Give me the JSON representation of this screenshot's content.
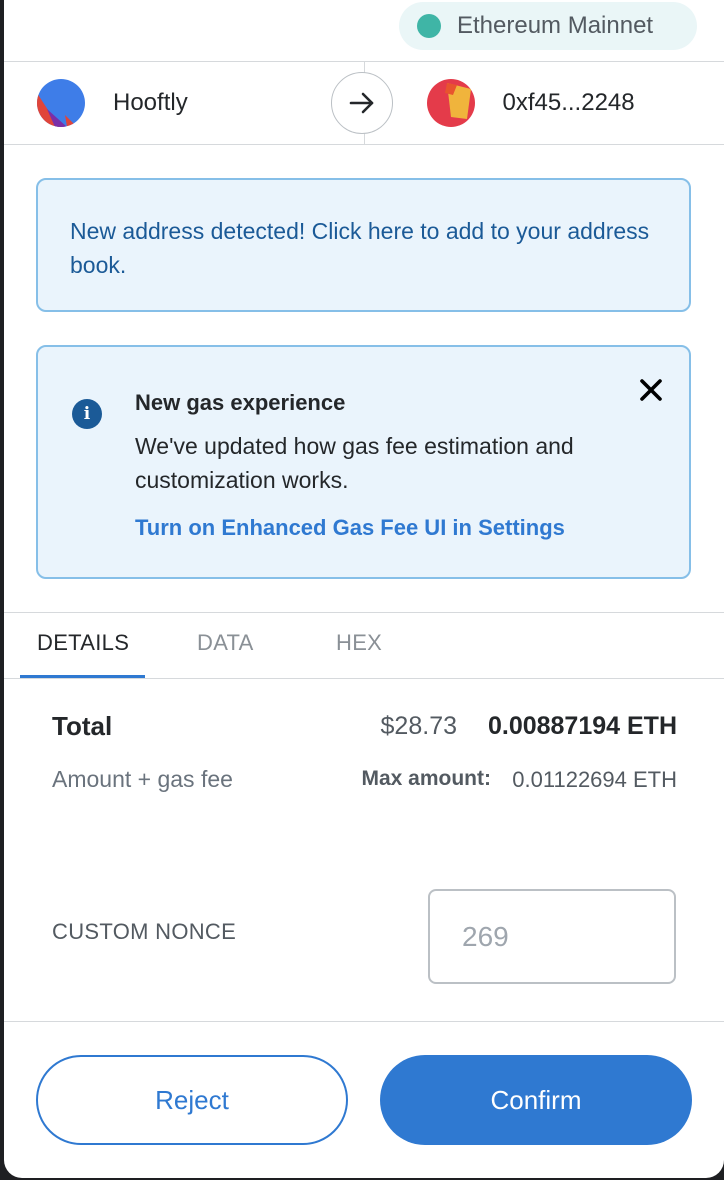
{
  "network": {
    "label": "Ethereum Mainnet",
    "dot_color": "#3fb5a6"
  },
  "accounts": {
    "from_name": "Hooftly",
    "to_address": "0xf45...2248"
  },
  "notice": {
    "text": "New address detected! Click here to add to your address book."
  },
  "gas_notice": {
    "title": "New gas experience",
    "body": "We've updated how gas fee estimation and customization works.",
    "link": "Turn on Enhanced Gas Fee UI in Settings"
  },
  "tabs": {
    "details": "DETAILS",
    "data": "DATA",
    "hex": "HEX"
  },
  "summary": {
    "total_label": "Total",
    "total_fiat": "$28.73",
    "total_eth": "0.00887194 ETH",
    "sub_label": "Amount + gas fee",
    "max_label": "Max amount:",
    "max_value": "0.01122694 ETH"
  },
  "nonce": {
    "label": "CUSTOM NONCE",
    "placeholder": "269"
  },
  "actions": {
    "reject": "Reject",
    "confirm": "Confirm"
  },
  "colors": {
    "accent": "#2f79d1",
    "notice_bg": "#eaf4fc",
    "notice_border": "#86bfe8"
  }
}
